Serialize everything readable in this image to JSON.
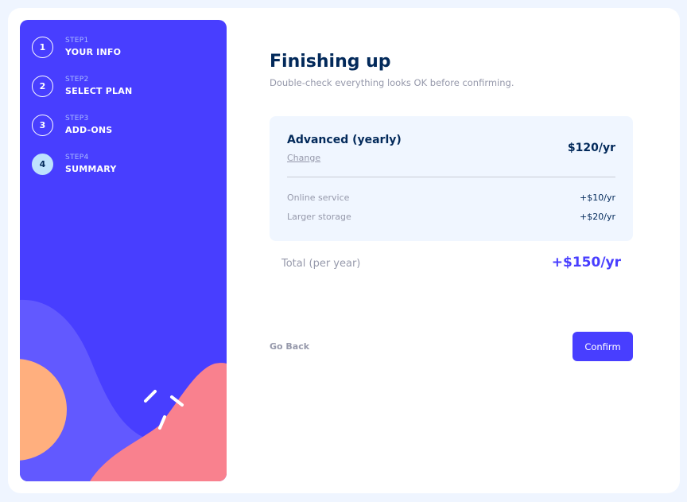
{
  "sidebar": {
    "steps": [
      {
        "number": "1",
        "label": "STEP1",
        "name": "YOUR INFO"
      },
      {
        "number": "2",
        "label": "STEP2",
        "name": "SELECT PLAN"
      },
      {
        "number": "3",
        "label": "STEP3",
        "name": "ADD-ONS"
      },
      {
        "number": "4",
        "label": "STEP4",
        "name": "SUMMARY"
      }
    ],
    "active_step": "4"
  },
  "main": {
    "title": "Finishing up",
    "subtitle": "Double-check everything looks OK before confirming.",
    "plan": {
      "name": "Advanced (yearly)",
      "change_label": "Change",
      "price": "$120/yr"
    },
    "addons": [
      {
        "name": "Online service",
        "price": "+$10/yr"
      },
      {
        "name": "Larger storage",
        "price": "+$20/yr"
      }
    ],
    "total": {
      "label": "Total (per year)",
      "price": "+$150/yr"
    }
  },
  "actions": {
    "back_label": "Go Back",
    "confirm_label": "Confirm"
  },
  "colors": {
    "sidebar_bg": "#483eff",
    "active_step_bg": "#bee2fd",
    "marine_blue": "#02295a",
    "cool_gray": "#9699ab",
    "purplish_blue": "#483eff",
    "summary_bg": "#f0f6ff",
    "orange_blob": "#ffaf7e",
    "pink_blob": "#f9818e",
    "light_purple_blob": "#6259ff"
  }
}
